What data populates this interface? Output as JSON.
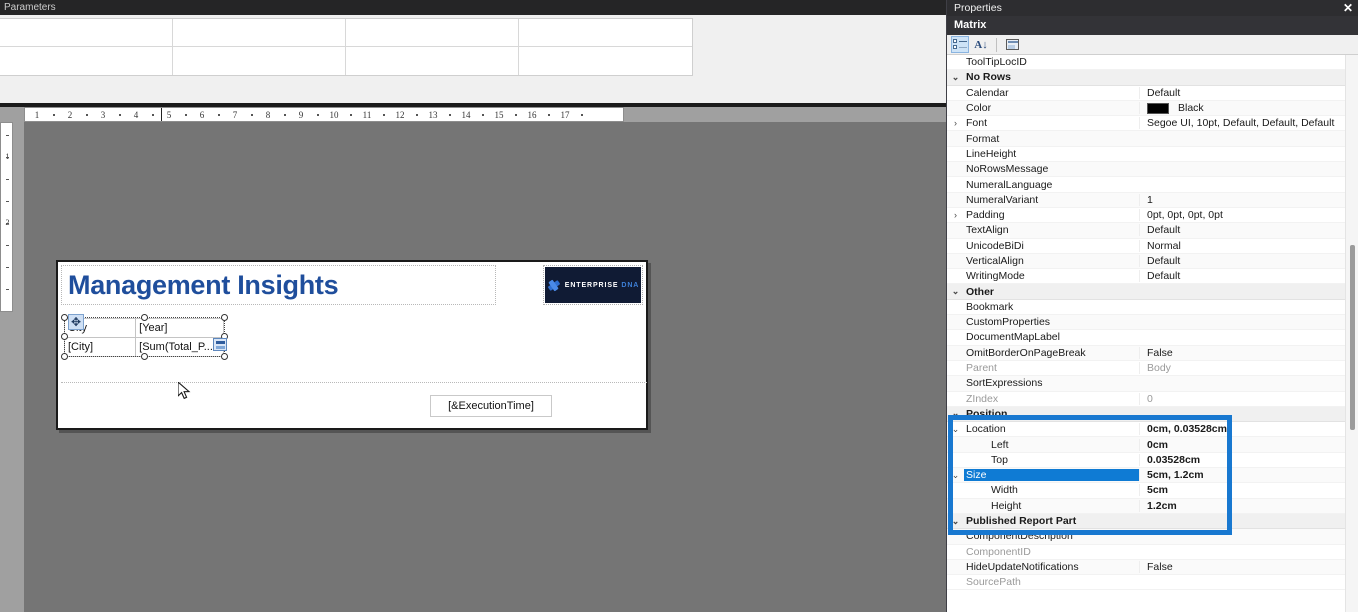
{
  "designer": {
    "parameters_pane": {
      "title": "Parameters",
      "grid_rows": 2,
      "grid_cols": 4
    },
    "ruler_h": {
      "ticks": [
        "1",
        "2",
        "3",
        "4",
        "5",
        "6",
        "7",
        "8",
        "9",
        "10",
        "11",
        "12",
        "13",
        "14",
        "15",
        "16",
        "17"
      ],
      "divider_after": "4"
    },
    "ruler_v": {
      "ticks": [
        "1",
        "2"
      ]
    },
    "report": {
      "title_textbox": "Management Insights",
      "logo": {
        "word1": "ENTERPRISE",
        "word2": "DNA",
        "background": "#101b34"
      },
      "matrix": {
        "cells": [
          [
            "City",
            "[Year]"
          ],
          [
            "[City]",
            "[Sum(Total_P..."
          ]
        ]
      },
      "footer_textbox": "[&ExecutionTime]"
    }
  },
  "properties": {
    "titlebar": {
      "title": "Properties",
      "close": "✕"
    },
    "object_name": "Matrix",
    "toolbar": {
      "categorized": "categorized-view",
      "alphabetical": "A↓",
      "property_pages": "property-pages"
    },
    "rows": [
      {
        "name": "ToolTipLocID",
        "value": "",
        "level": 1,
        "type": "prop"
      },
      {
        "name": "No Rows",
        "value": "",
        "level": 0,
        "type": "category",
        "expander": "⌄"
      },
      {
        "name": "Calendar",
        "value": "Default",
        "level": 1,
        "type": "prop"
      },
      {
        "name": "Color",
        "value": "Black",
        "level": 1,
        "type": "prop",
        "swatch": "#000000"
      },
      {
        "name": "Font",
        "value": "Segoe UI, 10pt, Default, Default, Default",
        "level": 1,
        "type": "prop",
        "expander": "›"
      },
      {
        "name": "Format",
        "value": "",
        "level": 1,
        "type": "prop"
      },
      {
        "name": "LineHeight",
        "value": "",
        "level": 1,
        "type": "prop"
      },
      {
        "name": "NoRowsMessage",
        "value": "",
        "level": 1,
        "type": "prop"
      },
      {
        "name": "NumeralLanguage",
        "value": "",
        "level": 1,
        "type": "prop"
      },
      {
        "name": "NumeralVariant",
        "value": "1",
        "level": 1,
        "type": "prop"
      },
      {
        "name": "Padding",
        "value": "0pt, 0pt, 0pt, 0pt",
        "level": 1,
        "type": "prop",
        "expander": "›"
      },
      {
        "name": "TextAlign",
        "value": "Default",
        "level": 1,
        "type": "prop"
      },
      {
        "name": "UnicodeBiDi",
        "value": "Normal",
        "level": 1,
        "type": "prop"
      },
      {
        "name": "VerticalAlign",
        "value": "Default",
        "level": 1,
        "type": "prop"
      },
      {
        "name": "WritingMode",
        "value": "Default",
        "level": 1,
        "type": "prop"
      },
      {
        "name": "Other",
        "value": "",
        "level": 0,
        "type": "category",
        "expander": "⌄"
      },
      {
        "name": "Bookmark",
        "value": "",
        "level": 1,
        "type": "prop"
      },
      {
        "name": "CustomProperties",
        "value": "",
        "level": 1,
        "type": "prop"
      },
      {
        "name": "DocumentMapLabel",
        "value": "",
        "level": 1,
        "type": "prop"
      },
      {
        "name": "OmitBorderOnPageBreak",
        "value": "False",
        "level": 1,
        "type": "prop"
      },
      {
        "name": "Parent",
        "value": "Body",
        "level": 1,
        "type": "prop",
        "dim": true
      },
      {
        "name": "SortExpressions",
        "value": "",
        "level": 1,
        "type": "prop"
      },
      {
        "name": "ZIndex",
        "value": "0",
        "level": 1,
        "type": "prop",
        "dim": true
      },
      {
        "name": "Position",
        "value": "",
        "level": 0,
        "type": "category",
        "expander": "⌄"
      },
      {
        "name": "Location",
        "value": "0cm, 0.03528cm",
        "level": 1,
        "type": "prop",
        "expander": "⌄",
        "bold": true
      },
      {
        "name": "Left",
        "value": "0cm",
        "level": 2,
        "type": "prop",
        "bold": true
      },
      {
        "name": "Top",
        "value": "0.03528cm",
        "level": 2,
        "type": "prop",
        "bold": true
      },
      {
        "name": "Size",
        "value": "5cm, 1.2cm",
        "level": 1,
        "type": "prop",
        "expander": "⌄",
        "selected": true,
        "bold": true
      },
      {
        "name": "Width",
        "value": "5cm",
        "level": 2,
        "type": "prop",
        "bold": true
      },
      {
        "name": "Height",
        "value": "1.2cm",
        "level": 2,
        "type": "prop",
        "bold": true
      },
      {
        "name": "Published Report Part",
        "value": "",
        "level": 0,
        "type": "category",
        "expander": "⌄"
      },
      {
        "name": "ComponentDescription",
        "value": "",
        "level": 1,
        "type": "prop"
      },
      {
        "name": "ComponentID",
        "value": "",
        "level": 1,
        "type": "prop",
        "dim": true
      },
      {
        "name": "HideUpdateNotifications",
        "value": "False",
        "level": 1,
        "type": "prop"
      },
      {
        "name": "SourcePath",
        "value": "",
        "level": 1,
        "type": "prop",
        "dim": true
      }
    ],
    "highlight_color": "#1878d0",
    "selection_color": "#0f7bd4"
  }
}
